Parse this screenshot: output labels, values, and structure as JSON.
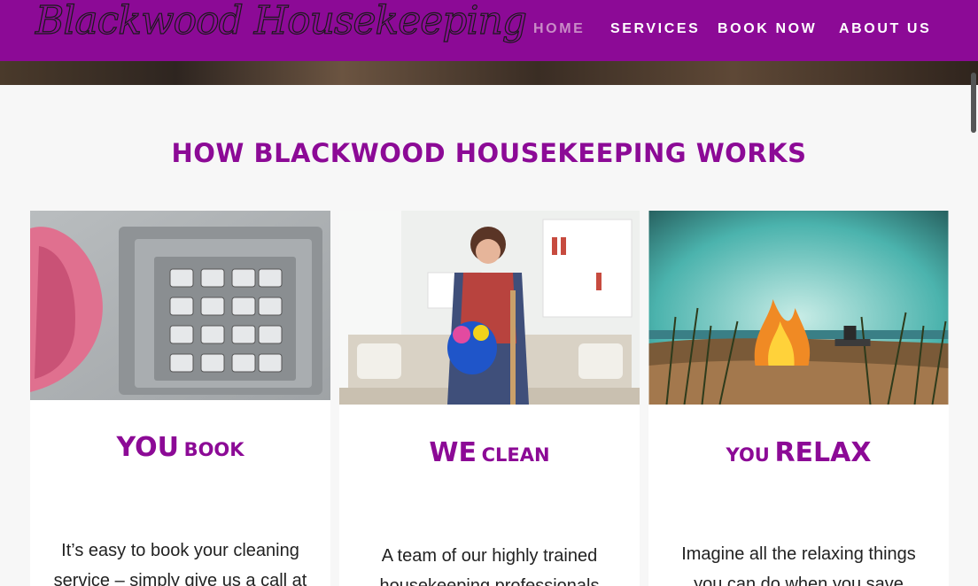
{
  "header": {
    "logo_text": "Blackwood Housekeeping",
    "nav": [
      {
        "label": "HOME",
        "active": true
      },
      {
        "label": "SERVICES"
      },
      {
        "label": "BOOK NOW"
      },
      {
        "label": "ABOUT US"
      }
    ]
  },
  "main": {
    "title": "HOW BLACKWOOD HOUSEKEEPING WORKS",
    "cards": [
      {
        "heading_a": "YOU",
        "heading_b": "BOOK",
        "text": "It’s easy to book your cleaning service – simply give us a call at",
        "image": "payphone-keypad-photo"
      },
      {
        "heading_a": "WE",
        "heading_b": "CLEAN",
        "text": "A team of our highly trained housekeeping professionals",
        "image": "cleaner-thumbs-up-photo"
      },
      {
        "heading_a": "YOU",
        "heading_b": "RELAX",
        "text": "Imagine all the relaxing things you can do when you save",
        "image": "beach-campfire-photo"
      }
    ]
  },
  "colors": {
    "brand": "#8c0a96",
    "nav_active": "#c98cc7"
  }
}
